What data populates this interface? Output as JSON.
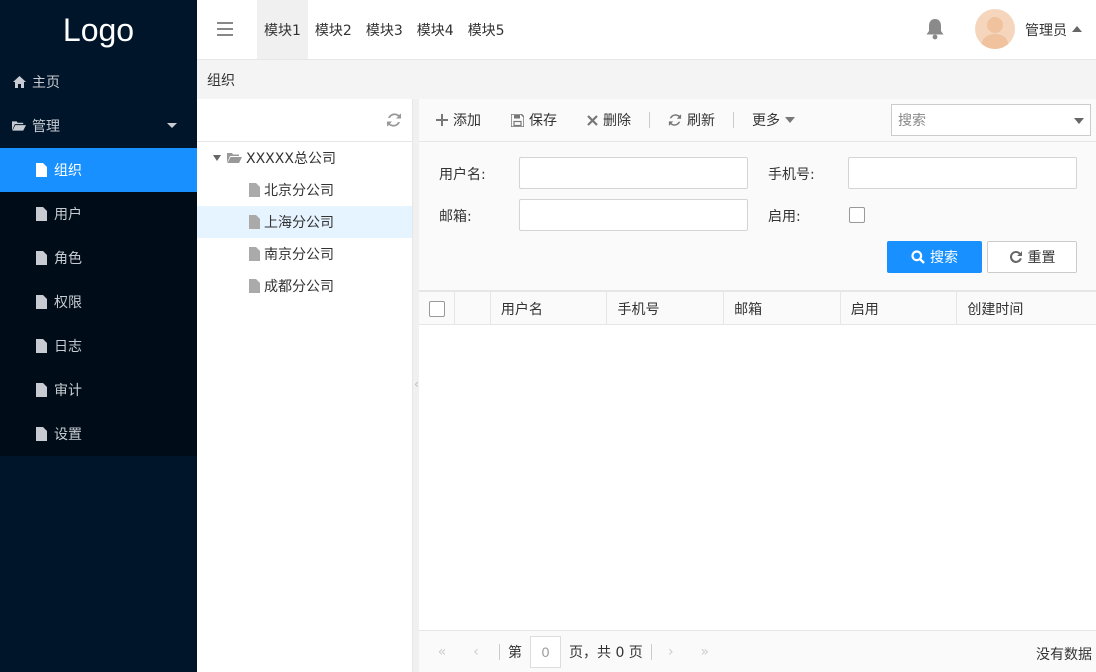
{
  "logo": "Logo",
  "colors": {
    "sidebar_bg": "#001529",
    "accent": "#1890ff"
  },
  "sidebar": {
    "home": {
      "label": "主页",
      "icon": "home-icon"
    },
    "manage": {
      "label": "管理",
      "icon": "folder-open-icon"
    },
    "items": [
      {
        "label": "组织",
        "active": true
      },
      {
        "label": "用户"
      },
      {
        "label": "角色"
      },
      {
        "label": "权限"
      },
      {
        "label": "日志"
      },
      {
        "label": "审计"
      },
      {
        "label": "设置"
      }
    ]
  },
  "header": {
    "modules": [
      "模块1",
      "模块2",
      "模块3",
      "模块4",
      "模块5"
    ],
    "user_name": "管理员"
  },
  "breadcrumb": "组织",
  "tree": {
    "root": "XXXXX总公司",
    "children": [
      "北京分公司",
      "上海分公司",
      "南京分公司",
      "成都分公司"
    ],
    "selected": "上海分公司"
  },
  "toolbar": {
    "add": "添加",
    "save": "保存",
    "delete": "删除",
    "refresh": "刷新",
    "more": "更多",
    "search_placeholder": "搜索"
  },
  "form": {
    "username_label": "用户名:",
    "phone_label": "手机号:",
    "email_label": "邮箱:",
    "enabled_label": "启用:",
    "search_button": "搜索",
    "reset_button": "重置"
  },
  "table": {
    "columns": [
      "用户名",
      "手机号",
      "邮箱",
      "启用",
      "创建时间"
    ]
  },
  "pager": {
    "page_prefix": "第",
    "page_value": "0",
    "page_suffix": "页，共 0 页",
    "no_data": "没有数据"
  }
}
